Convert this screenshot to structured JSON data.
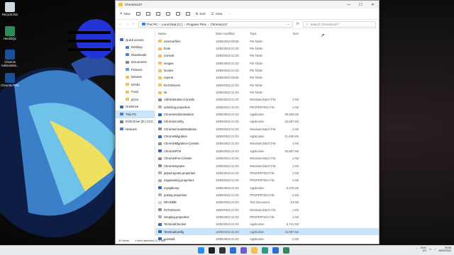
{
  "desktop": {
    "icons": [
      {
        "label": "Recycle Bin",
        "icon": "recycle-bin-icon",
        "color": "#cfd8e3"
      },
      {
        "label": "HeidiSQL",
        "icon": "heidisql-icon",
        "color": "#2e8b57"
      },
      {
        "label": "Chromis Administrat...",
        "icon": "chromis-admin-icon",
        "color": "#1a4f9c"
      },
      {
        "label": "Chromis POS",
        "icon": "chromis-pos-icon",
        "color": "#1a4f9c"
      }
    ]
  },
  "window": {
    "title": "Chromis147",
    "controls": {
      "minimize": "—",
      "maximize": "☐",
      "close": "✕"
    },
    "toolbar": {
      "new_label": "New",
      "sort_label": "Sort",
      "view_label": "View",
      "more_label": "···"
    },
    "address": {
      "segments": [
        "This PC",
        "Local Disk (C:)",
        "Program Files",
        "Chromis147"
      ]
    },
    "search": {
      "placeholder": "Search Chromis147"
    },
    "nav": {
      "back": "←",
      "forward": "→",
      "up": "↑",
      "refresh": "⟳"
    }
  },
  "sidebar": {
    "items": [
      {
        "label": "Quick access",
        "icon": "star-icon",
        "color": "#2b6fd6",
        "indent": false
      },
      {
        "label": "Desktop",
        "icon": "desktop-icon",
        "color": "#3c82d6",
        "indent": true
      },
      {
        "label": "Downloads",
        "icon": "download-icon",
        "color": "#3c82d6",
        "indent": true
      },
      {
        "label": "Documents",
        "icon": "documents-icon",
        "color": "#7a8aa0",
        "indent": true
      },
      {
        "label": "Pictures",
        "icon": "pictures-icon",
        "color": "#4aa3df",
        "indent": true
      },
      {
        "label": "Deserts",
        "icon": "folder-icon",
        "color": "#f2c14e",
        "indent": true
      },
      {
        "label": "Drinks",
        "icon": "folder-icon",
        "color": "#f2c14e",
        "indent": true
      },
      {
        "label": "Food",
        "icon": "folder-icon",
        "color": "#f2c14e",
        "indent": true
      },
      {
        "label": "pizza",
        "icon": "folder-icon",
        "color": "#f2c14e",
        "indent": true
      },
      {
        "label": "OneDrive",
        "icon": "cloud-icon",
        "color": "#2b6fd6",
        "indent": false
      },
      {
        "label": "This PC",
        "icon": "pc-icon",
        "color": "#3c82d6",
        "indent": false,
        "selected": true
      },
      {
        "label": "DVD Drive (D:) CCC",
        "icon": "dvd-icon",
        "color": "#777777",
        "indent": false
      },
      {
        "label": "Network",
        "icon": "network-icon",
        "color": "#3c82d6",
        "indent": false
      }
    ]
  },
  "columns": {
    "name": "Name",
    "date": "Date modified",
    "type": "Type",
    "size": "Size"
  },
  "files": [
    {
      "name": "external files",
      "date": "18/05/2022 09:05",
      "type": "File folder",
      "size": "",
      "kind": "folder"
    },
    {
      "name": "fonts",
      "date": "18/05/2022 21:03",
      "type": "File folder",
      "size": "",
      "kind": "folder"
    },
    {
      "name": "icons45",
      "date": "18/05/2022 21:03",
      "type": "File folder",
      "size": "",
      "kind": "folder"
    },
    {
      "name": "images",
      "date": "18/05/2022 21:03",
      "type": "File folder",
      "size": "",
      "kind": "folder"
    },
    {
      "name": "locales",
      "date": "18/05/2022 21:03",
      "type": "File folder",
      "size": "",
      "kind": "folder"
    },
    {
      "name": "reports",
      "date": "18/05/2022 09:06",
      "type": "File folder",
      "size": "",
      "kind": "folder"
    },
    {
      "name": "RxTxDrivers",
      "date": "18/05/2022 21:03",
      "type": "File folder",
      "size": "",
      "kind": "folder"
    },
    {
      "name": "sk",
      "date": "18/05/2022 21:03",
      "type": "File folder",
      "size": "",
      "kind": "folder"
    },
    {
      "name": "Administration-Console",
      "date": "18/05/2022 21:03",
      "type": "Windows Batch File",
      "size": "1 KB",
      "kind": "bat"
    },
    {
      "name": "adminlog.properties",
      "date": "18/05/2022 21:03",
      "type": "PROPERTIES File",
      "size": "1 KB",
      "kind": "prop"
    },
    {
      "name": "ChromisAdministration",
      "date": "18/05/2022 21:03",
      "type": "Application",
      "size": "90,683 KB",
      "kind": "app"
    },
    {
      "name": "ChromisConfig",
      "date": "18/05/2022 21:03",
      "type": "Application",
      "size": "22,887 KB",
      "kind": "app"
    },
    {
      "name": "ChromisCreateDatabase",
      "date": "18/05/2022 21:03",
      "type": "Windows Batch File",
      "size": "1 KB",
      "kind": "bat"
    },
    {
      "name": "ChromisMigration",
      "date": "18/05/2022 21:03",
      "type": "Application",
      "size": "21,930 KB",
      "kind": "app"
    },
    {
      "name": "ChromisMigration-Console",
      "date": "18/05/2022 21:03",
      "type": "Windows Batch File",
      "size": "1 KB",
      "kind": "bat"
    },
    {
      "name": "ChromisPOS",
      "date": "18/05/2022 21:03",
      "type": "Application",
      "size": "33,667 KB",
      "kind": "app"
    },
    {
      "name": "ChromisPos-Console",
      "date": "18/05/2022 21:03",
      "type": "Windows Batch File",
      "size": "1 KB",
      "kind": "bat"
    },
    {
      "name": "ChromisSystem",
      "date": "18/05/2022 21:03",
      "type": "Windows Batch File",
      "size": "1 KB",
      "kind": "bat"
    },
    {
      "name": "jasperreports.properties",
      "date": "18/05/2022 21:03",
      "type": "PROPERTIES File",
      "size": "1 KB",
      "kind": "prop"
    },
    {
      "name": "migrationlog.properties",
      "date": "18/05/2022 21:03",
      "type": "PROPERTIES File",
      "size": "1 KB",
      "kind": "prop"
    },
    {
      "name": "mysqldump",
      "date": "18/05/2022 21:03",
      "type": "Application",
      "size": "6,370 KB",
      "kind": "app"
    },
    {
      "name": "poslog.properties",
      "date": "18/05/2022 21:03",
      "type": "PROPERTIES File",
      "size": "1 KB",
      "kind": "prop"
    },
    {
      "name": "README",
      "date": "18/05/2022 21:03",
      "type": "Text Document",
      "size": "13 KB",
      "kind": "txt"
    },
    {
      "name": "RxTxDrivers",
      "date": "18/05/2022 21:03",
      "type": "Windows Batch File",
      "size": "1 KB",
      "kind": "bat"
    },
    {
      "name": "setuplog.properties",
      "date": "18/05/2022 21:03",
      "type": "PROPERTIES File",
      "size": "1 KB",
      "kind": "prop"
    },
    {
      "name": "TerminalChecker",
      "date": "18/05/2022 21:03",
      "type": "Application",
      "size": "8,721 KB",
      "kind": "app"
    },
    {
      "name": "TerminalConfig",
      "date": "18/05/2022 21:03",
      "type": "Application",
      "size": "22,887 KB",
      "kind": "app",
      "selected": true
    },
    {
      "name": "uninstall",
      "date": "18/05/2022 21:03",
      "type": "Application",
      "size": "1 KB",
      "kind": "app"
    }
  ],
  "kind_colors": {
    "folder": "#f2c14e",
    "bat": "#8a8f98",
    "prop": "#b0b0b0",
    "app": "#2f6fc2",
    "txt": "#c9ccd1"
  },
  "status": {
    "items": "32 items",
    "selected": "1 item selected  22.1 MB"
  },
  "taskbar": {
    "apps": [
      {
        "icon": "start-icon",
        "color": "#1e90ff"
      },
      {
        "icon": "search-icon",
        "color": "#222222"
      },
      {
        "icon": "task-view-icon",
        "color": "#333333"
      },
      {
        "icon": "widgets-icon",
        "color": "#2b6fd6"
      },
      {
        "icon": "chat-icon",
        "color": "#6b5bd6"
      },
      {
        "icon": "file-explorer-icon",
        "color": "#f2c14e"
      },
      {
        "icon": "edge-icon",
        "color": "#1f9e89"
      },
      {
        "icon": "store-icon",
        "color": "#2b6fd6"
      },
      {
        "icon": "heidisql-icon",
        "color": "#2e8b57"
      }
    ],
    "lang": "ENG",
    "region": "US",
    "time": "09:06",
    "date": "18/05/2022"
  }
}
